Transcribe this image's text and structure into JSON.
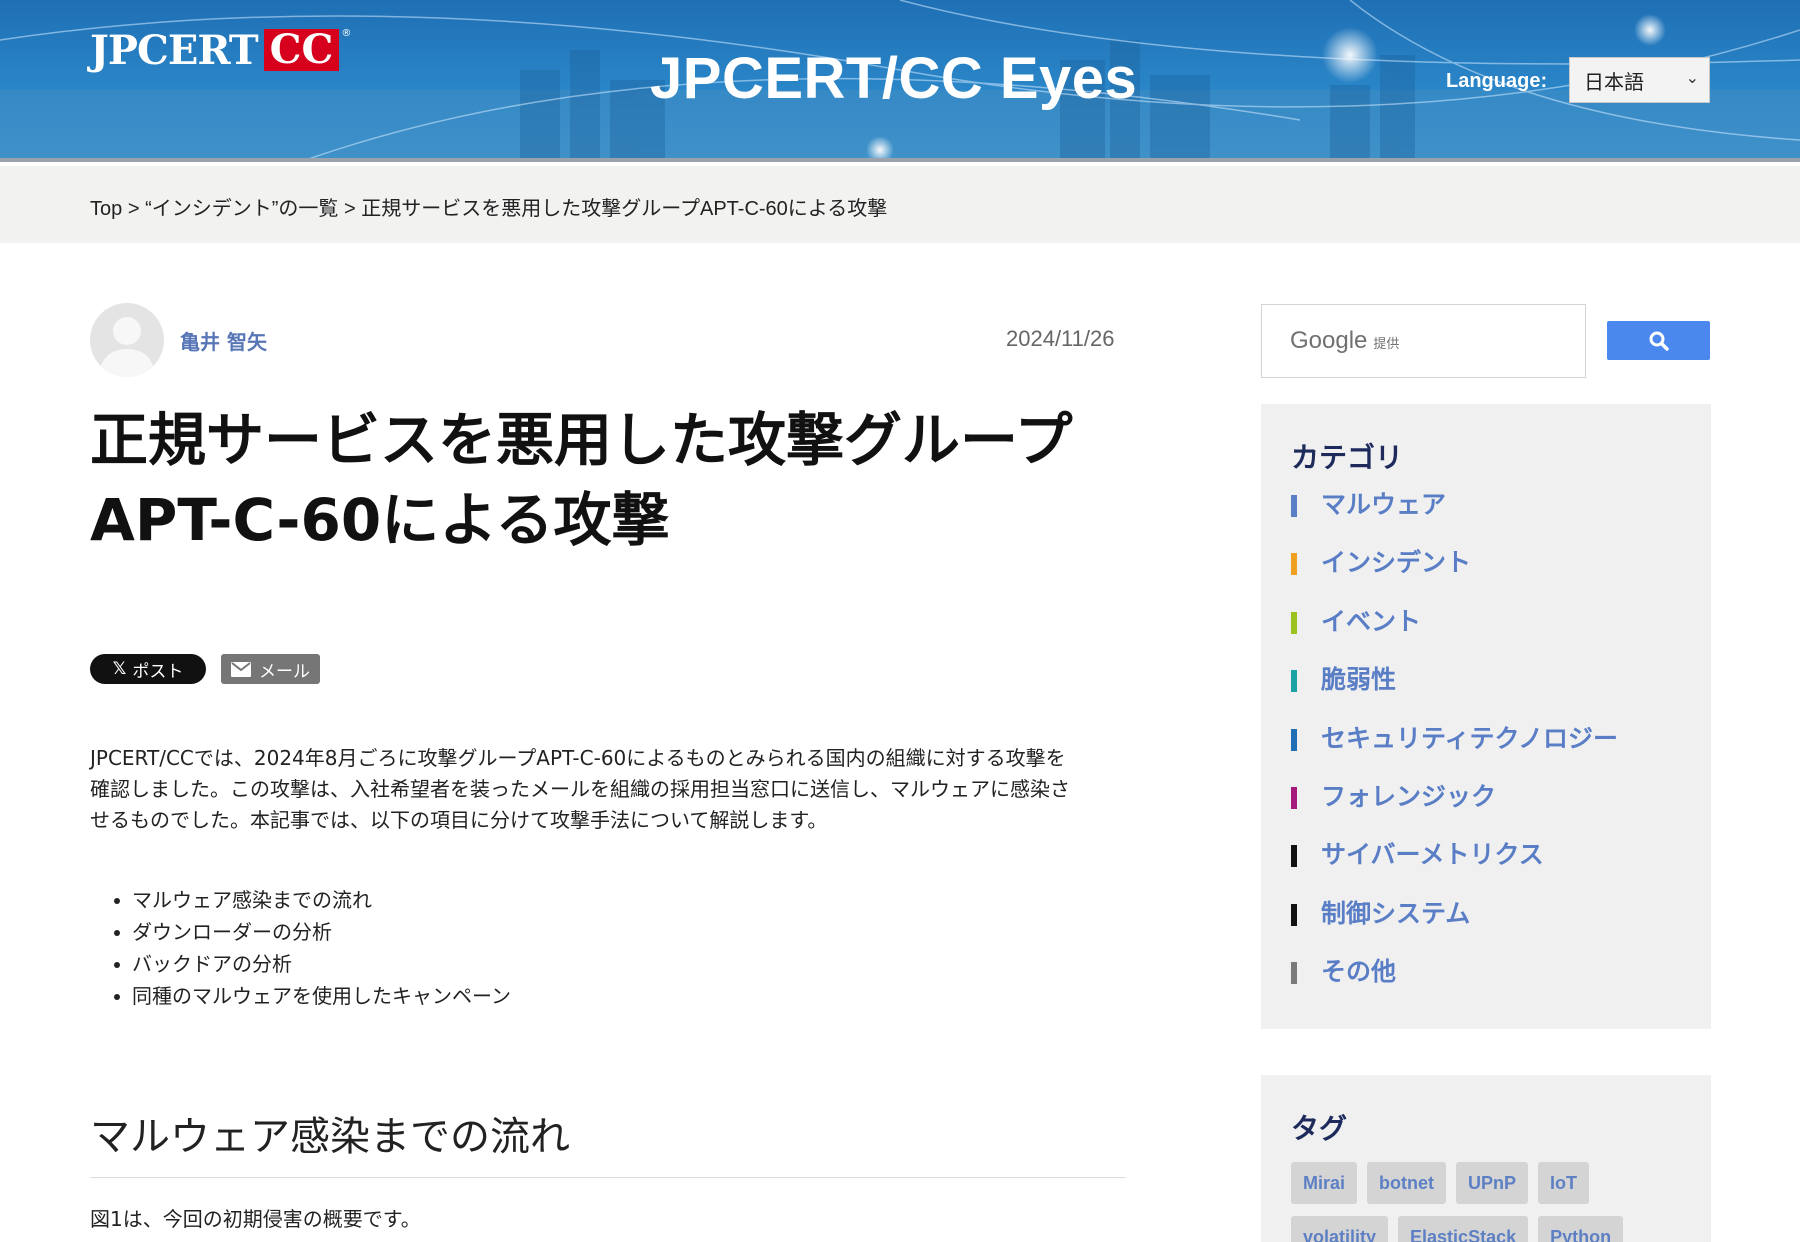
{
  "header": {
    "logo_left": "JPCERT",
    "logo_right": "CC",
    "logo_mark": "®",
    "site_title": "JPCERT/CC Eyes",
    "language_label": "Language:",
    "language_selected": "日本語"
  },
  "breadcrumb": {
    "top": "Top",
    "separator": ">",
    "category": "“インシデント”の一覧",
    "current": "正規サービスを悪用した攻撃グループAPT-C-60による攻撃"
  },
  "article": {
    "author": "亀井 智矢",
    "date": "2024/11/26",
    "title_line1": "正規サービスを悪用した攻撃グループ",
    "title_line2": "APT-C-60による攻撃",
    "share_post_label": "ポスト",
    "share_post_icon": "x-icon",
    "share_mail_label": "メール",
    "share_mail_icon": "envelope-icon",
    "intro_line1": "JPCERT/CCでは、2024年8月ごろに攻撃グループAPT-C-60によるものとみられる国内の組織に対する攻撃を",
    "intro_line2": "確認しました。この攻撃は、入社希望者を装ったメールを組織の採用担当窓口に送信し、マルウェアに感染さ",
    "intro_line3": "せるものでした。本記事では、以下の項目に分けて攻撃手法について解説します。",
    "toc": [
      "マルウェア感染までの流れ",
      "ダウンローダーの分析",
      "バックドアの分析",
      "同種のマルウェアを使用したキャンペーン"
    ],
    "section_heading": "マルウェア感染までの流れ",
    "section_text": "図1は、今回の初期侵害の概要です。"
  },
  "sidebar": {
    "search_brand": "Google",
    "search_brand_sub": "提供",
    "search_button_icon": "search-icon",
    "categories_title": "カテゴリ",
    "categories": [
      {
        "label": "マルウェア",
        "color": "#5a7ec6"
      },
      {
        "label": "インシデント",
        "color": "#f0a020"
      },
      {
        "label": "イベント",
        "color": "#9cc21e"
      },
      {
        "label": "脆弱性",
        "color": "#1ba3a3"
      },
      {
        "label": "セキュリティテクノロジー",
        "color": "#1e6fb5"
      },
      {
        "label": "フォレンジック",
        "color": "#a3197c"
      },
      {
        "label": "サイバーメトリクス",
        "color": "#111111"
      },
      {
        "label": "制御システム",
        "color": "#111111"
      },
      {
        "label": "その他",
        "color": "#7a7a7a"
      }
    ],
    "tags_title": "タグ",
    "tags": [
      "Mirai",
      "botnet",
      "UPnP",
      "IoT",
      "volatility",
      "ElasticStack",
      "Python"
    ]
  },
  "colors": {
    "header_blue": "#2a86c8",
    "link_blue": "#5a7ec6",
    "search_button": "#4a88ee",
    "logo_red": "#d6001c"
  }
}
